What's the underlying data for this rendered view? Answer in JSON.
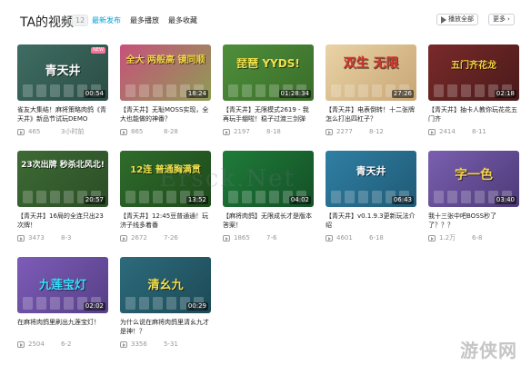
{
  "header": {
    "title": "TA的视频",
    "count": "12",
    "tabs": [
      {
        "label": "最新发布",
        "active": true
      },
      {
        "label": "最多播放",
        "active": false
      },
      {
        "label": "最多收藏",
        "active": false
      }
    ],
    "play_all_label": "播放全部",
    "more_label": "更多"
  },
  "colors": {
    "accent": "#00a1d6",
    "meta": "#999999",
    "new_badge": "#fb7299"
  },
  "videos": [
    {
      "thumb_text": "青天井",
      "badge": "NEW",
      "duration": "00:54",
      "title": "雀友大集结！麻将策略肉鸽《青天井》新品节试玩DEMO",
      "views": "465",
      "date": "3小时前"
    },
    {
      "thumb_text": "全大 两般高 镜同顺",
      "badge": "",
      "duration": "18:24",
      "title": "【青天井】无耻MOSS实现，全大也能做的神番？",
      "views": "865",
      "date": "8-28"
    },
    {
      "thumb_text": "琵琶 YYDS!",
      "badge": "",
      "duration": "01:28:34",
      "title": "【青天井】无限模式2619 - 我再玩手绷啦！稳子过渡三剑弹",
      "views": "2197",
      "date": "8-18"
    },
    {
      "thumb_text": "双生 无限",
      "badge": "",
      "duration": "27:26",
      "title": "【青天井】电表倒转！十二张牌怎么打出四杠子？",
      "views": "2277",
      "date": "8-12"
    },
    {
      "thumb_text": "五门齐花龙",
      "badge": "",
      "duration": "02:18",
      "title": "【青天井】抽卡人教你玩花花五门齐",
      "views": "2414",
      "date": "8-11"
    },
    {
      "thumb_text": "23次出牌 秒杀北风北!",
      "badge": "",
      "duration": "20:57",
      "title": "【青天井】16局的全连只出23次牌！",
      "views": "3473",
      "date": "8-3"
    },
    {
      "thumb_text": "12连 普通胸满贯",
      "badge": "",
      "duration": "13:52",
      "title": "【青天井】12:45豆普通通！玩济子线多着番",
      "views": "2672",
      "date": "7-26"
    },
    {
      "thumb_text": "",
      "badge": "",
      "duration": "04:02",
      "title": "【麻将肉鸽】无限成长才是版本答案！",
      "views": "1865",
      "date": "7-6"
    },
    {
      "thumb_text": "青天井",
      "badge": "",
      "duration": "06:43",
      "title": "【青天井】v0.1.9.3更新玩法介绍",
      "views": "4601",
      "date": "6-18"
    },
    {
      "thumb_text": "字一色",
      "badge": "",
      "duration": "03:40",
      "title": "我十三张中吧BOSS秒了了？？？",
      "views": "1.2万",
      "date": "6-8"
    },
    {
      "thumb_text": "九莲宝灯",
      "badge": "",
      "duration": "02:02",
      "title": "在麻将肉鸽里刷出九莲宝灯！",
      "views": "2504",
      "date": "6-2"
    },
    {
      "thumb_text": "清幺九",
      "badge": "",
      "duration": "00:29",
      "title": "为什么说在麻将肉鸽里清幺九才是神！？",
      "views": "3356",
      "date": "5-31"
    }
  ],
  "watermark": {
    "center": "Ersck.Net",
    "corner": "游侠网"
  }
}
